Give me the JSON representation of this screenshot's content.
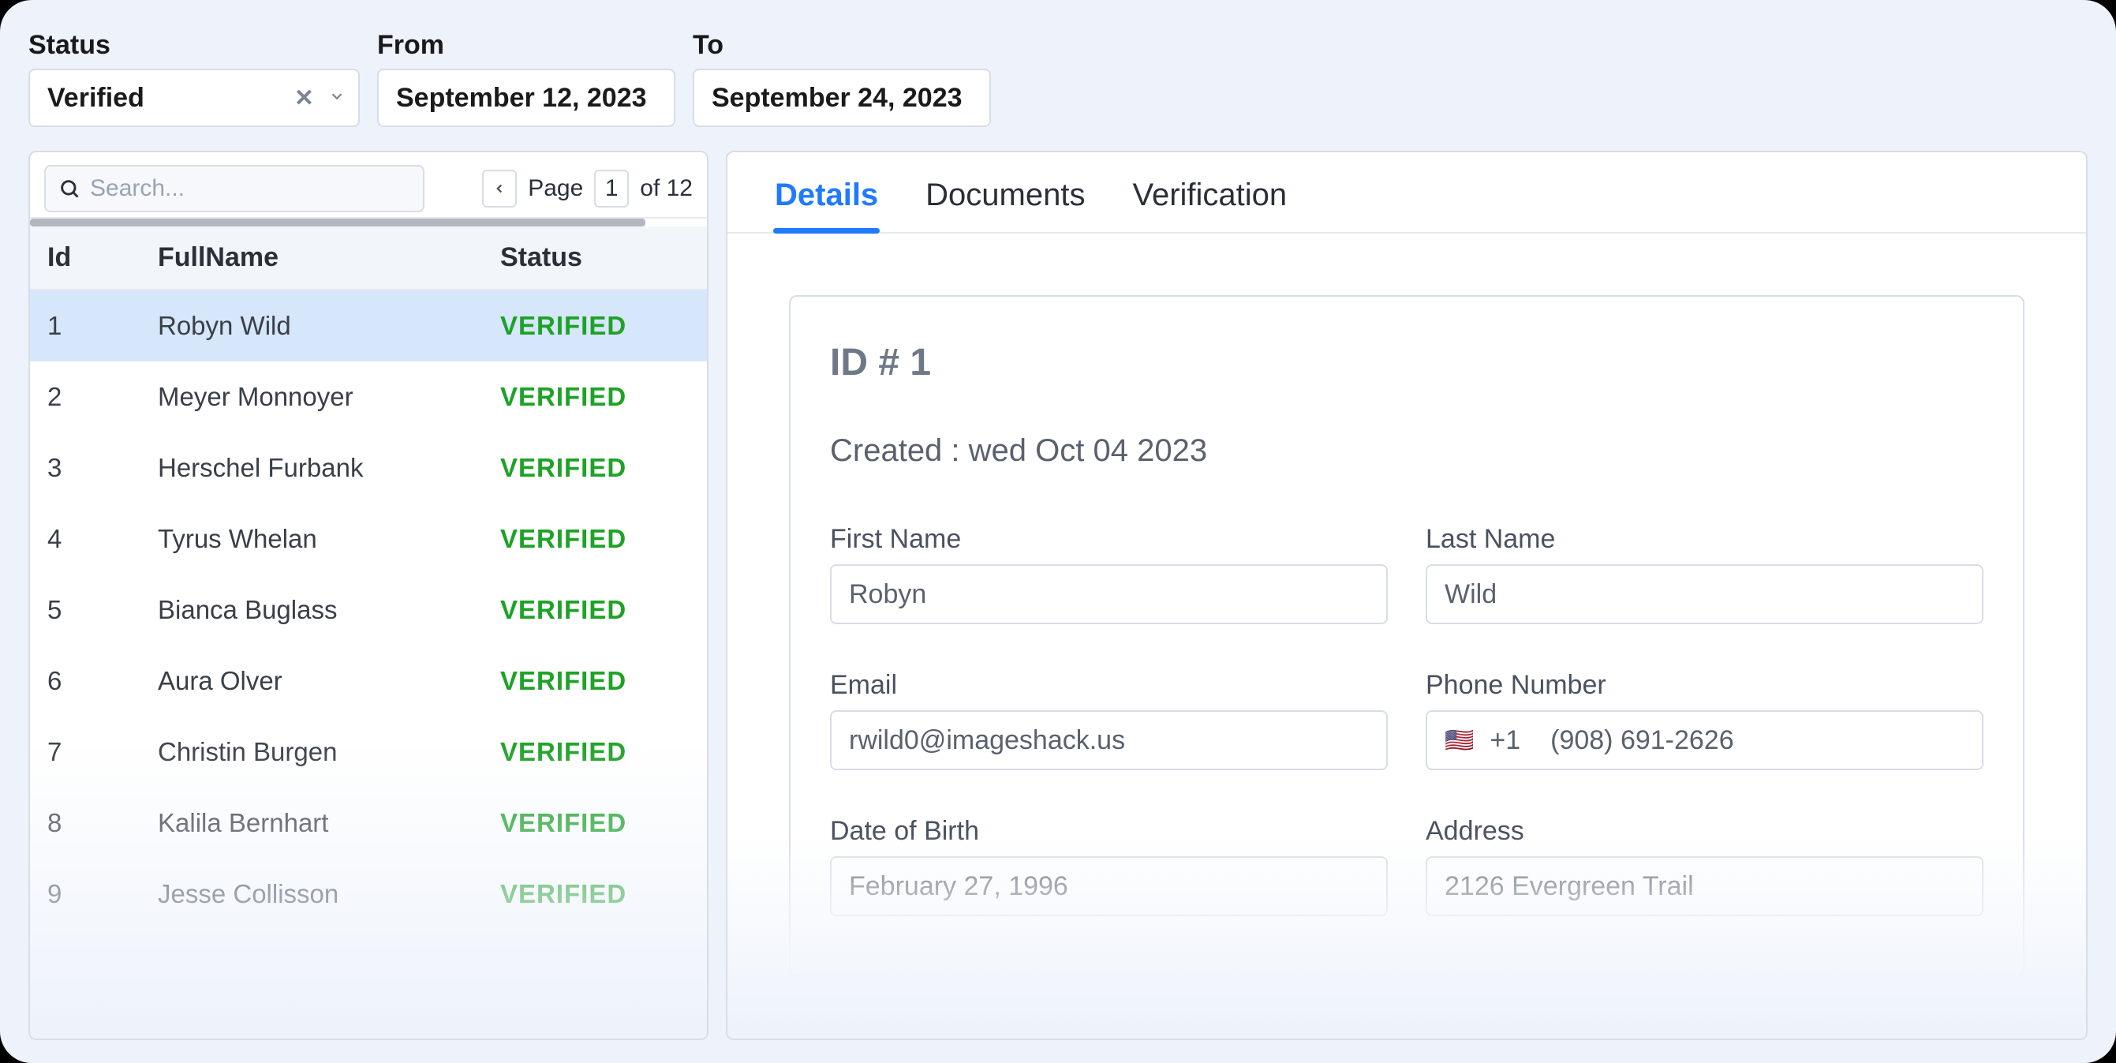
{
  "filters": {
    "status_label": "Status",
    "status_value": "Verified",
    "from_label": "From",
    "from_value": "September 12, 2023",
    "to_label": "To",
    "to_value": "September 24, 2023"
  },
  "search": {
    "placeholder": "Search..."
  },
  "pager": {
    "page_label": "Page",
    "page": "1",
    "of_label": "of 12"
  },
  "columns": {
    "id": "Id",
    "fullname": "FullName",
    "status": "Status"
  },
  "rows": [
    {
      "id": "1",
      "name": "Robyn Wild",
      "status": "VERIFIED"
    },
    {
      "id": "2",
      "name": "Meyer Monnoyer",
      "status": "VERIFIED"
    },
    {
      "id": "3",
      "name": "Herschel Furbank",
      "status": "VERIFIED"
    },
    {
      "id": "4",
      "name": "Tyrus Whelan",
      "status": "VERIFIED"
    },
    {
      "id": "5",
      "name": "Bianca Buglass",
      "status": "VERIFIED"
    },
    {
      "id": "6",
      "name": "Aura Olver",
      "status": "VERIFIED"
    },
    {
      "id": "7",
      "name": "Christin Burgen",
      "status": "VERIFIED"
    },
    {
      "id": "8",
      "name": "Kalila Bernhart",
      "status": "VERIFIED"
    },
    {
      "id": "9",
      "name": "Jesse Collisson",
      "status": "VERIFIED"
    }
  ],
  "tabs": {
    "details": "Details",
    "documents": "Documents",
    "verification": "Verification"
  },
  "detail": {
    "id_line": "ID # 1",
    "created": "Created : wed Oct 04 2023",
    "first_name_label": "First Name",
    "first_name": "Robyn",
    "last_name_label": "Last Name",
    "last_name": "Wild",
    "email_label": "Email",
    "email": "rwild0@imageshack.us",
    "phone_label": "Phone Number",
    "phone_cc": "+1",
    "phone": "(908) 691-2626",
    "dob_label": "Date of Birth",
    "dob": "February 27, 1996",
    "address_label": "Address",
    "address": "2126 Evergreen Trail"
  }
}
